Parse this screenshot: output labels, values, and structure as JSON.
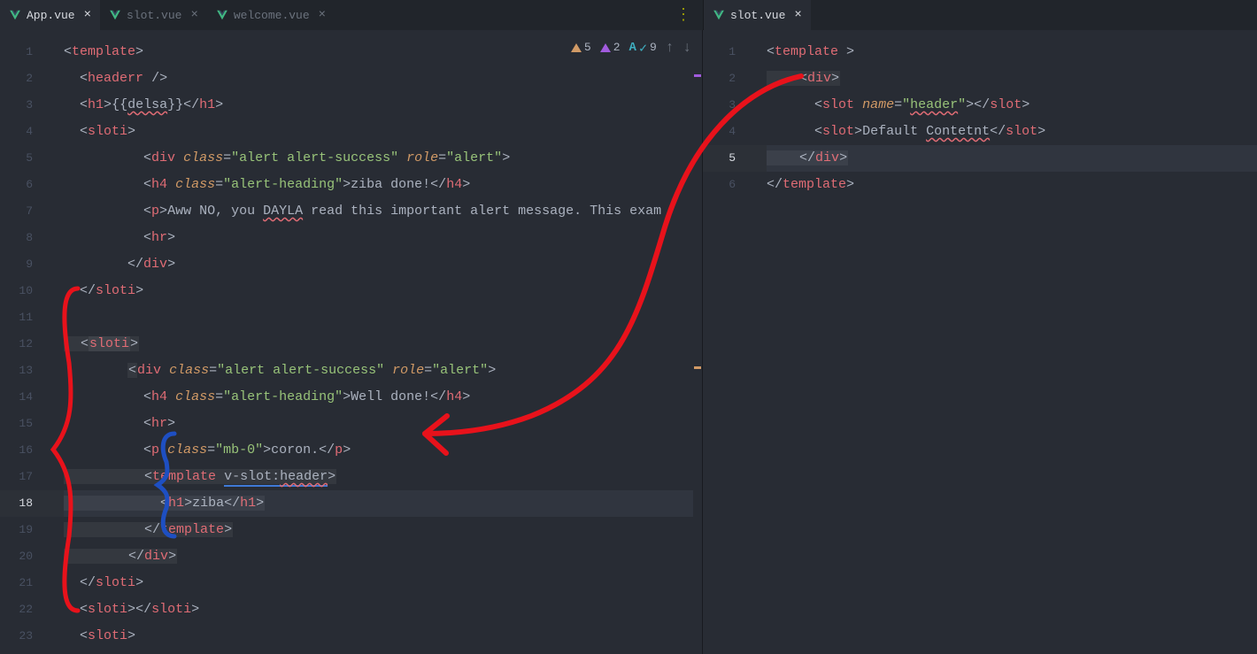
{
  "tabs_left": [
    {
      "label": "App.vue",
      "active": true
    },
    {
      "label": "slot.vue",
      "active": false
    },
    {
      "label": "welcome.vue",
      "active": false
    }
  ],
  "tabs_right": [
    {
      "label": "slot.vue",
      "active": true
    }
  ],
  "inspections": {
    "warn": "5",
    "err": "2",
    "typo": "9"
  },
  "left_code": {
    "line1": "<template>",
    "line2": "  <headerr />",
    "line3": "  <h1>{{delsa}}</h1>",
    "line4": "  <sloti>",
    "line5": "          <div class=\"alert alert-success\" role=\"alert\">",
    "line6": "          <h4 class=\"alert-heading\">ziba done!</h4>",
    "line7": "          <p>Aww NO, you DAYLA read this important alert message. This exam",
    "line8": "          <hr>",
    "line9": "        </div>",
    "line10": "  </sloti>",
    "line11": "",
    "line12": "  <sloti>",
    "line13": "        <div class=\"alert alert-success\" role=\"alert\">",
    "line14": "          <h4 class=\"alert-heading\">Well done!</h4>",
    "line15": "          <hr>",
    "line16": "          <p class=\"mb-0\">coron.</p>",
    "line17": "          <template v-slot:header>",
    "line18": "            <h1>ziba</h1>",
    "line19": "          </template>",
    "line20": "        </div>",
    "line21": "  </sloti>",
    "line22": "  <sloti></sloti>",
    "line23": "  <sloti>"
  },
  "right_code": {
    "line1": "<template >",
    "line2": "    <div>",
    "line3": "      <slot name=\"header\"></slot>",
    "line4": "      <slot>Default Contetnt</slot>",
    "line5": "    </div>",
    "line6": "</template>"
  },
  "current_left_line": 18,
  "current_right_line": 5,
  "line_count_left": 23,
  "line_count_right": 6
}
